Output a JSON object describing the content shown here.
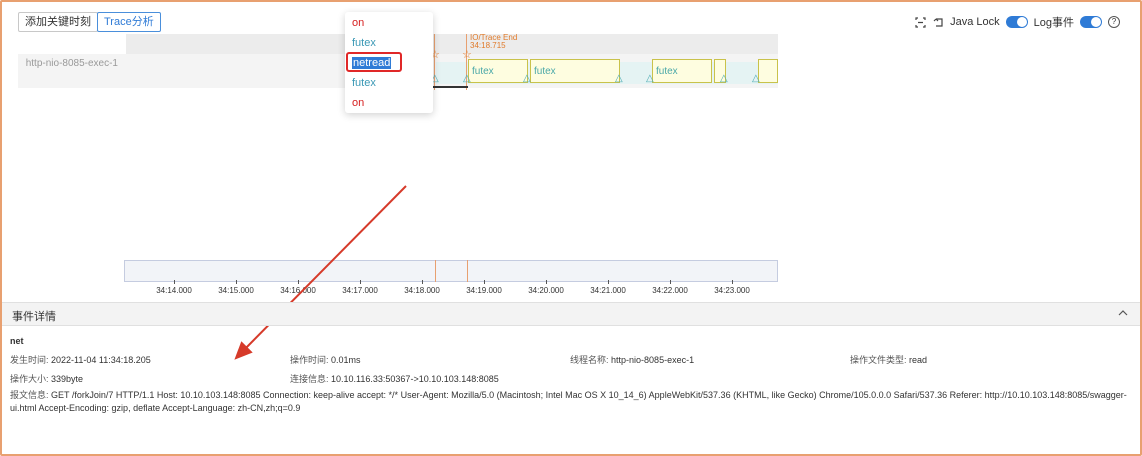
{
  "toolbar": {
    "add_keyframe_label": "添加关键时刻",
    "trace_analysis_label": "Trace分析"
  },
  "right_tools": {
    "java_lock_label": "Java Lock",
    "log_event_label": "Log事件",
    "java_lock_on": true,
    "log_event_on": true,
    "accent": "#2f7bd6"
  },
  "thread": {
    "label": "http-nio-8085-exec-1"
  },
  "trace_end": {
    "label": "IO/Trace End",
    "time": "34:18.715"
  },
  "segments": [
    {
      "label": "futex"
    },
    {
      "label": "futex"
    },
    {
      "label": "futex"
    },
    {
      "label": ""
    },
    {
      "label": ""
    }
  ],
  "dropdown": {
    "items": [
      {
        "label": "on",
        "tone": "red"
      },
      {
        "label": "futex",
        "tone": "teal"
      },
      {
        "label": "netread",
        "tone": "selected"
      },
      {
        "label": "futex",
        "tone": "teal"
      },
      {
        "label": "on",
        "tone": "red"
      }
    ]
  },
  "axis": {
    "ticks": [
      "34:14.000",
      "34:15.000",
      "34:16.000",
      "34:17.000",
      "34:18.000",
      "34:19.000",
      "34:20.000",
      "34:21.000",
      "34:22.000",
      "34:23.000"
    ]
  },
  "details": {
    "section_title": "事件详情",
    "event_name": "net",
    "occur_time_key": "发生时间:",
    "occur_time": "2022-11-04 11:34:18.205",
    "op_time_key": "操作时间:",
    "op_time": "0.01ms",
    "thread_name_key": "线程名称:",
    "thread_name": "http-nio-8085-exec-1",
    "op_file_type_key": "操作文件类型:",
    "op_file_type": "read",
    "op_size_key": "操作大小:",
    "op_size": "339byte",
    "conn_key": "连接信息:",
    "conn": "10.10.116.33:50367->10.10.103.148:8085",
    "packet_key": "报文信息:",
    "packet": "GET /forkJoin/7 HTTP/1.1 Host: 10.10.103.148:8085 Connection: keep-alive accept: */* User-Agent: Mozilla/5.0 (Macintosh; Intel Mac OS X 10_14_6) AppleWebKit/537.36 (KHTML, like Gecko) Chrome/105.0.0.0 Safari/537.36 Referer: http://10.10.103.148:8085/swagger-ui.html Accept-Encoding: gzip, deflate Accept-Language: zh-CN,zh;q=0.9"
  },
  "colors": {
    "frame_border": "#e8a070",
    "segment_fill": "#fefde0",
    "segment_border": "#c9c24a",
    "marker": "#4aaab2",
    "annotation_arrow": "#d63a2a"
  }
}
